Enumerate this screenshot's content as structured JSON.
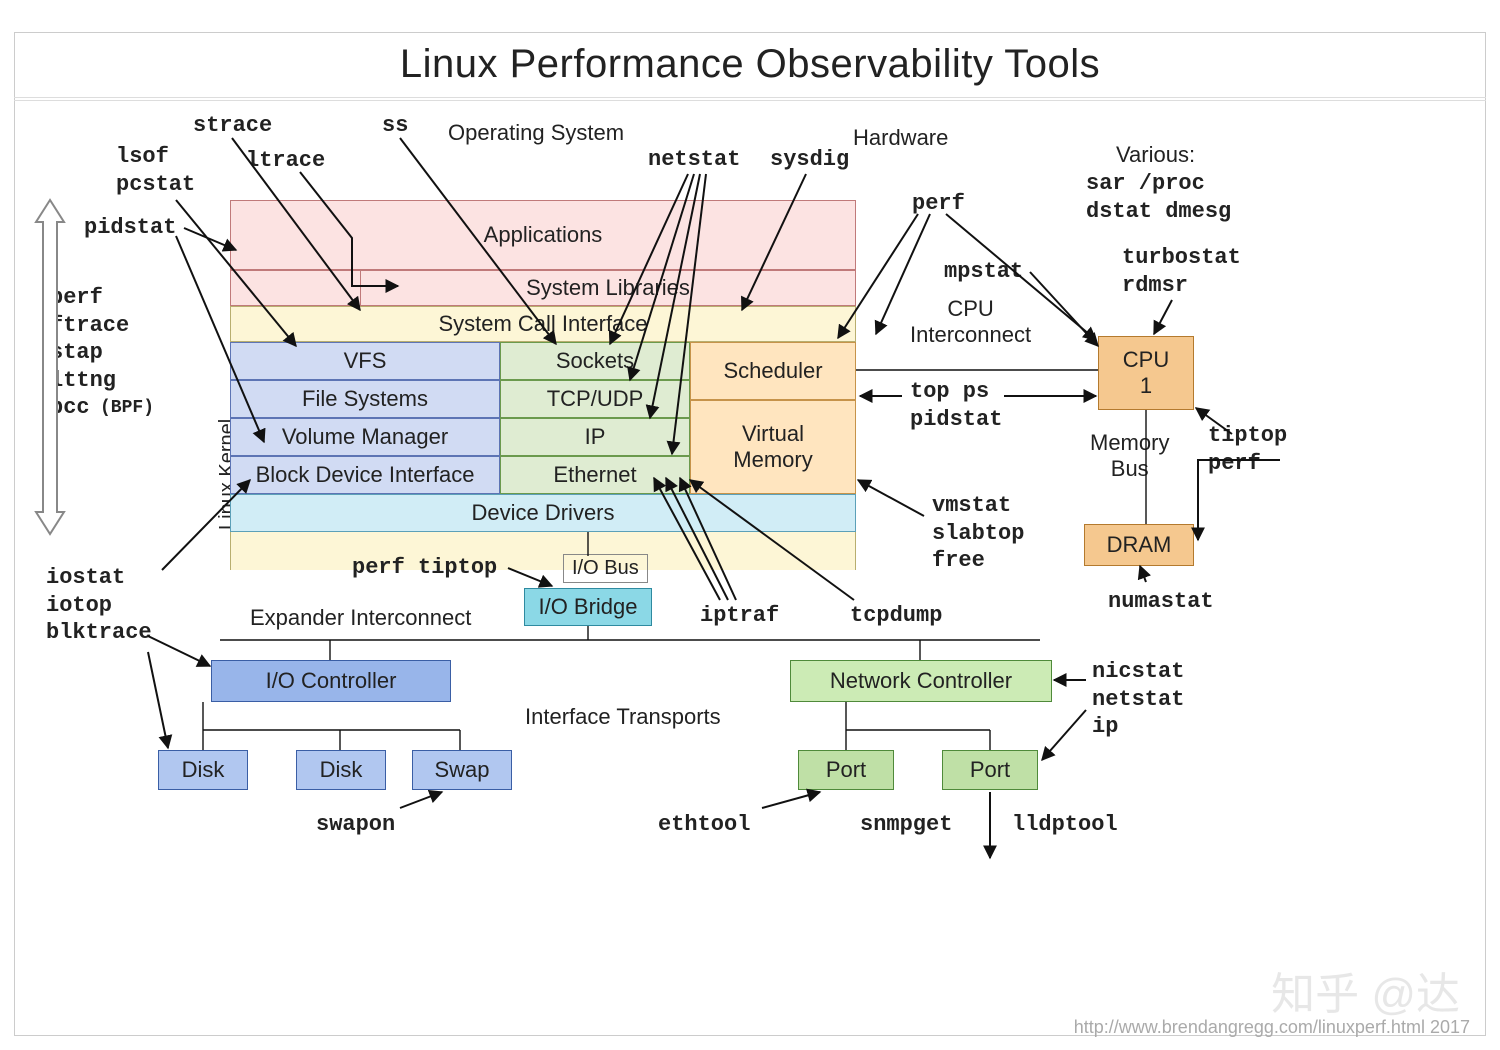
{
  "title": "Linux Performance Observability Tools",
  "section_headers": {
    "os": "Operating System",
    "hw": "Hardware",
    "various": "Various:"
  },
  "vlabel": "Linux Kernel",
  "hw_labels": {
    "cpu_interconnect": "CPU\nInterconnect",
    "memory_bus": "Memory\nBus",
    "io_bus": "I/O Bus",
    "expander": "Expander Interconnect",
    "iface": "Interface Transports"
  },
  "layers": {
    "applications": "Applications",
    "syslibs": "System Libraries",
    "sci": "System Call Interface",
    "vfs": "VFS",
    "fs": "File Systems",
    "vmgr": "Volume Manager",
    "bdi": "Block Device Interface",
    "sockets": "Sockets",
    "tcpudp": "TCP/UDP",
    "ip": "IP",
    "eth": "Ethernet",
    "sched": "Scheduler",
    "vmem": "Virtual\nMemory",
    "drivers": "Device Drivers",
    "iobridge": "I/O Bridge",
    "ioctrl": "I/O Controller",
    "netctrl": "Network Controller",
    "disk": "Disk",
    "swap": "Swap",
    "port": "Port",
    "cpu": "CPU\n1",
    "dram": "DRAM"
  },
  "tools": {
    "strace": "strace",
    "ss": "ss",
    "lsof_pcstat": "lsof\npcstat",
    "ltrace": "ltrace",
    "pidstat": "pidstat",
    "kernel_tracers": "perf\nftrace\nstap\nlttng\nbcc",
    "bpf_note": "(BPF)",
    "netstat": "netstat",
    "sysdig": "sysdig",
    "perf_cpu": "perf",
    "mpstat": "mpstat",
    "sar_etc": "sar /proc\ndstat dmesg",
    "turbostat": "turbostat\nrdmsr",
    "top_ps_pidstat": "top ps\npidstat",
    "vmstat_etc": "vmstat\nslabtop\nfree",
    "tiptop_perf": "tiptop\nperf",
    "numastat": "numastat",
    "iostat_etc": "iostat\niotop\nblktrace",
    "perf_tiptop": "perf tiptop",
    "iptraf": "iptraf",
    "tcpdump": "tcpdump",
    "nicstat_etc": "nicstat\nnetstat\nip",
    "swapon": "swapon",
    "ethtool": "ethtool",
    "snmpget": "snmpget",
    "lldptool": "lldptool"
  },
  "footer": "http://www.brendangregg.com/linuxperf.html 2017",
  "watermark": "知乎 @达"
}
